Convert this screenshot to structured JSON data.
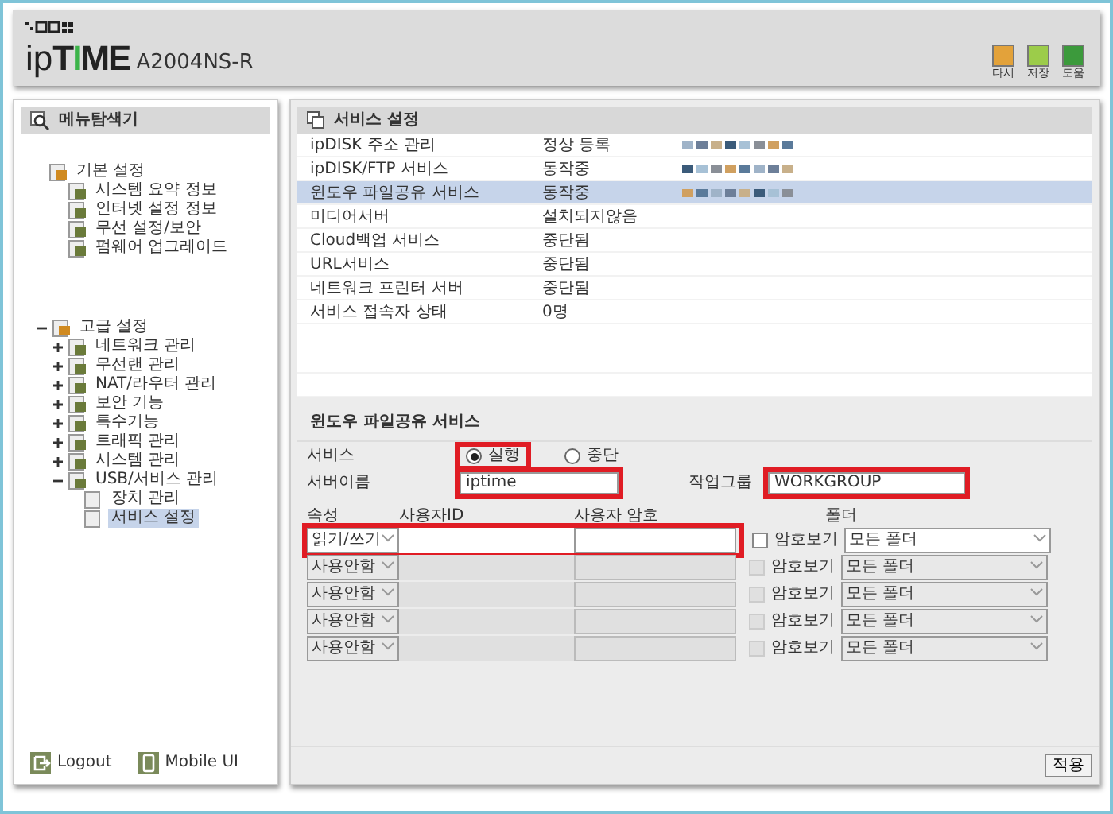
{
  "header": {
    "logo_prefix": "ip",
    "logo_main": "TIME",
    "model": "A2004NS-R",
    "tools": [
      {
        "label": "다시",
        "color": "#e3a23a"
      },
      {
        "label": "저장",
        "color": "#9ccc4a"
      },
      {
        "label": "도움",
        "color": "#3c9a3c"
      }
    ]
  },
  "sidebar": {
    "title": "메뉴탐색기",
    "tree": [
      {
        "label": "기본 설정",
        "children": [
          {
            "label": "시스템 요약 정보"
          },
          {
            "label": "인터넷 설정 정보"
          },
          {
            "label": "무선 설정/보안"
          },
          {
            "label": "펌웨어 업그레이드"
          }
        ]
      },
      {
        "label": "고급 설정",
        "expanded": true,
        "children": [
          {
            "label": "네트워크 관리",
            "expanded": false
          },
          {
            "label": "무선랜 관리",
            "expanded": false
          },
          {
            "label": "NAT/라우터 관리",
            "expanded": false
          },
          {
            "label": "보안 기능",
            "expanded": false
          },
          {
            "label": "특수기능",
            "expanded": false
          },
          {
            "label": "트래픽 관리",
            "expanded": false
          },
          {
            "label": "시스템 관리",
            "expanded": false
          },
          {
            "label": "USB/서비스 관리",
            "expanded": true,
            "children": [
              {
                "label": "장치 관리",
                "selected": false
              },
              {
                "label": "서비스 설정",
                "selected": true
              }
            ]
          }
        ]
      }
    ],
    "footer": [
      {
        "label": "Logout"
      },
      {
        "label": "Mobile UI"
      }
    ]
  },
  "services": {
    "title": "서비스 설정",
    "rows": [
      {
        "name": "ipDISK 주소 관리",
        "status": "정상 등록",
        "redacted": true,
        "selected": false
      },
      {
        "name": "ipDISK/FTP 서비스",
        "status": "동작중",
        "redacted": true,
        "selected": false
      },
      {
        "name": "윈도우 파일공유 서비스",
        "status": "동작중",
        "redacted": true,
        "selected": true
      },
      {
        "name": "미디어서버",
        "status": "설치되지않음",
        "redacted": false,
        "selected": false
      },
      {
        "name": "Cloud백업 서비스",
        "status": "중단됨",
        "redacted": false,
        "selected": false
      },
      {
        "name": "URL서비스",
        "status": "중단됨",
        "redacted": false,
        "selected": false
      },
      {
        "name": "네트워크 프린터 서버",
        "status": "중단됨",
        "redacted": false,
        "selected": false
      },
      {
        "name": "서비스 접속자 상태",
        "status": "0명",
        "redacted": false,
        "selected": false
      }
    ]
  },
  "sharing": {
    "title": "윈도우 파일공유 서비스",
    "service_label": "서비스",
    "options": [
      {
        "label": "실행",
        "selected": true,
        "highlighted": true
      },
      {
        "label": "중단",
        "selected": false,
        "highlighted": false
      }
    ],
    "server_name_label": "서버이름",
    "server_name": "iptime",
    "server_name_highlighted": true,
    "workgroup_label": "작업그룹",
    "workgroup": "WORKGROUP",
    "workgroup_highlighted": true,
    "columns": [
      "속성",
      "사용자ID",
      "사용자 암호",
      "폴더"
    ],
    "accounts": [
      {
        "mode": "읽기/쓰기",
        "disabled": false,
        "highlighted": true,
        "show_label": "암호보기",
        "show_checked": false,
        "folder": "모든 폴더"
      },
      {
        "mode": "사용안함",
        "disabled": true,
        "highlighted": false,
        "show_label": "암호보기",
        "show_checked": false,
        "folder": "모든 폴더"
      },
      {
        "mode": "사용안함",
        "disabled": true,
        "highlighted": false,
        "show_label": "암호보기",
        "show_checked": false,
        "folder": "모든 폴더"
      },
      {
        "mode": "사용안함",
        "disabled": true,
        "highlighted": false,
        "show_label": "암호보기",
        "show_checked": false,
        "folder": "모든 폴더"
      },
      {
        "mode": "사용안함",
        "disabled": true,
        "highlighted": false,
        "show_label": "암호보기",
        "show_checked": false,
        "folder": "모든 폴더"
      }
    ],
    "apply": "적용"
  }
}
